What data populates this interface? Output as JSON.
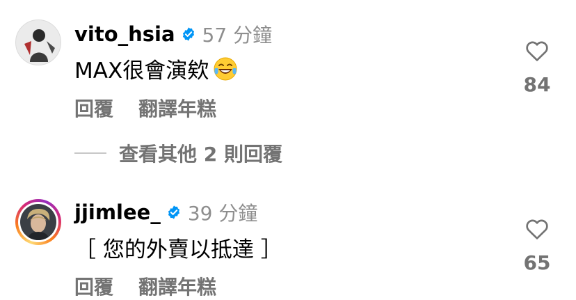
{
  "colors": {
    "primary_text": "#000000",
    "secondary_text": "#737373",
    "timestamp": "#8e8e8e",
    "verified_badge": "#0095f6",
    "heart_outline": "#737373"
  },
  "comments": [
    {
      "username": "vito_hsia",
      "verified": true,
      "timestamp": "57 分鐘",
      "text": "MAX很會演欸",
      "emoji": "tears-of-joy-emoji",
      "actions": {
        "reply": "回覆",
        "translate": "翻譯年糕"
      },
      "likes": "84",
      "avatar_story_ring": false
    },
    {
      "username": "jjimlee_",
      "verified": true,
      "timestamp": "39 分鐘",
      "text": "［ 您的外賣以抵達 ］",
      "actions": {
        "reply": "回覆",
        "translate": "翻譯年糕"
      },
      "likes": "65",
      "avatar_story_ring": true
    }
  ],
  "view_replies": {
    "label": "查看其他 2 則回覆"
  }
}
